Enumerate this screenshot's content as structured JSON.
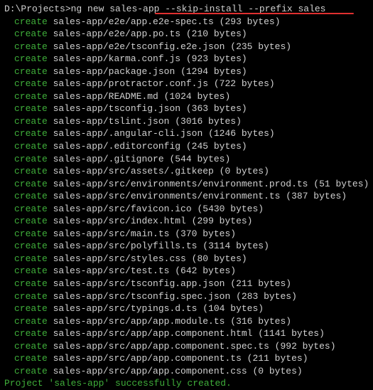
{
  "prompt": {
    "cwd": "D:\\Projects>",
    "command": "ng new sales-app --skip-install --prefix sales"
  },
  "lines": [
    {
      "path": "sales-app/e2e/app.e2e-spec.ts",
      "bytes": "293 bytes"
    },
    {
      "path": "sales-app/e2e/app.po.ts",
      "bytes": "210 bytes"
    },
    {
      "path": "sales-app/e2e/tsconfig.e2e.json",
      "bytes": "235 bytes"
    },
    {
      "path": "sales-app/karma.conf.js",
      "bytes": "923 bytes"
    },
    {
      "path": "sales-app/package.json",
      "bytes": "1294 bytes"
    },
    {
      "path": "sales-app/protractor.conf.js",
      "bytes": "722 bytes"
    },
    {
      "path": "sales-app/README.md",
      "bytes": "1024 bytes"
    },
    {
      "path": "sales-app/tsconfig.json",
      "bytes": "363 bytes"
    },
    {
      "path": "sales-app/tslint.json",
      "bytes": "3016 bytes"
    },
    {
      "path": "sales-app/.angular-cli.json",
      "bytes": "1246 bytes"
    },
    {
      "path": "sales-app/.editorconfig",
      "bytes": "245 bytes"
    },
    {
      "path": "sales-app/.gitignore",
      "bytes": "544 bytes"
    },
    {
      "path": "sales-app/src/assets/.gitkeep",
      "bytes": "0 bytes"
    },
    {
      "path": "sales-app/src/environments/environment.prod.ts",
      "bytes": "51 bytes"
    },
    {
      "path": "sales-app/src/environments/environment.ts",
      "bytes": "387 bytes"
    },
    {
      "path": "sales-app/src/favicon.ico",
      "bytes": "5430 bytes"
    },
    {
      "path": "sales-app/src/index.html",
      "bytes": "299 bytes"
    },
    {
      "path": "sales-app/src/main.ts",
      "bytes": "370 bytes"
    },
    {
      "path": "sales-app/src/polyfills.ts",
      "bytes": "3114 bytes"
    },
    {
      "path": "sales-app/src/styles.css",
      "bytes": "80 bytes"
    },
    {
      "path": "sales-app/src/test.ts",
      "bytes": "642 bytes"
    },
    {
      "path": "sales-app/src/tsconfig.app.json",
      "bytes": "211 bytes"
    },
    {
      "path": "sales-app/src/tsconfig.spec.json",
      "bytes": "283 bytes"
    },
    {
      "path": "sales-app/src/typings.d.ts",
      "bytes": "104 bytes"
    },
    {
      "path": "sales-app/src/app/app.module.ts",
      "bytes": "316 bytes"
    },
    {
      "path": "sales-app/src/app/app.component.html",
      "bytes": "1141 bytes"
    },
    {
      "path": "sales-app/src/app/app.component.spec.ts",
      "bytes": "992 bytes"
    },
    {
      "path": "sales-app/src/app/app.component.ts",
      "bytes": "211 bytes"
    },
    {
      "path": "sales-app/src/app/app.component.css",
      "bytes": "0 bytes"
    }
  ],
  "keyword": "create",
  "success": "Project 'sales-app' successfully created."
}
